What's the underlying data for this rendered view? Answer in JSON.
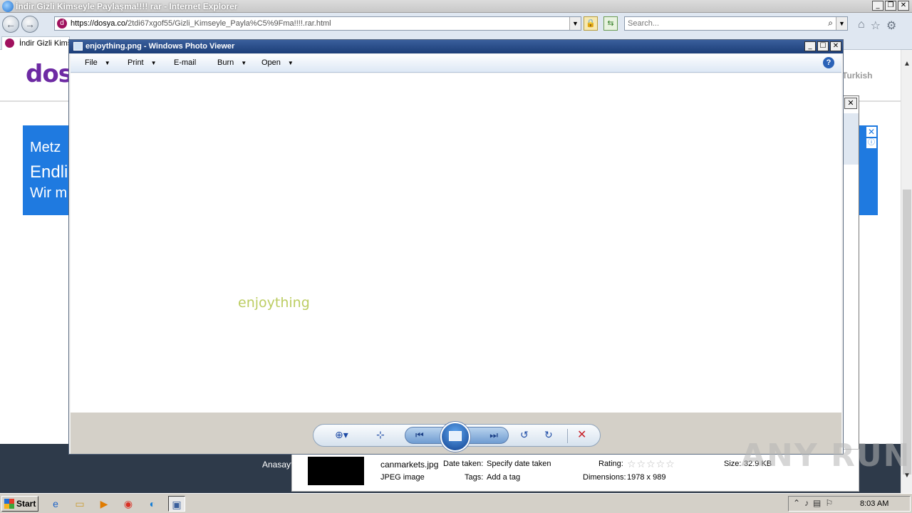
{
  "ie": {
    "title": "İndir Gizli Kimseyle Paylaşma!!!! rar - Internet Explorer",
    "url_host": "https://dosya.co/",
    "url_path": "2tdi67xgof55/Gizli_Kimseyle_Payla%C5%9Fma!!!!.rar.html",
    "search_placeholder": "Search...",
    "tab_label": "İndir Gizli Kimseyle Paylaşma!!!! rar"
  },
  "page": {
    "logo": "dosya",
    "language": "Turkish",
    "ad_line1": "Metz",
    "ad_line2": "Endlic",
    "ad_line3": "Wir m",
    "footer_link": "Anasayfa"
  },
  "photo_viewer": {
    "title": "enjoything.png - Windows Photo Viewer",
    "menu": [
      "File",
      "Print",
      "E-mail",
      "Burn",
      "Open"
    ],
    "image_text": "enjoything"
  },
  "details": {
    "filename": "canmarkets.jpg",
    "filetype": "JPEG image",
    "date_taken_label": "Date taken:",
    "date_taken_value": "Specify date taken",
    "tags_label": "Tags:",
    "tags_value": "Add a tag",
    "rating_label": "Rating:",
    "rating_stars": "☆☆☆☆☆",
    "dimensions_label": "Dimensions:",
    "dimensions_value": "1978 x 989",
    "size_label": "Size:",
    "size_value": "32.9 KB"
  },
  "taskbar": {
    "start_label": "Start",
    "clock": "8:03 AM"
  },
  "watermark": "ANY RUN"
}
